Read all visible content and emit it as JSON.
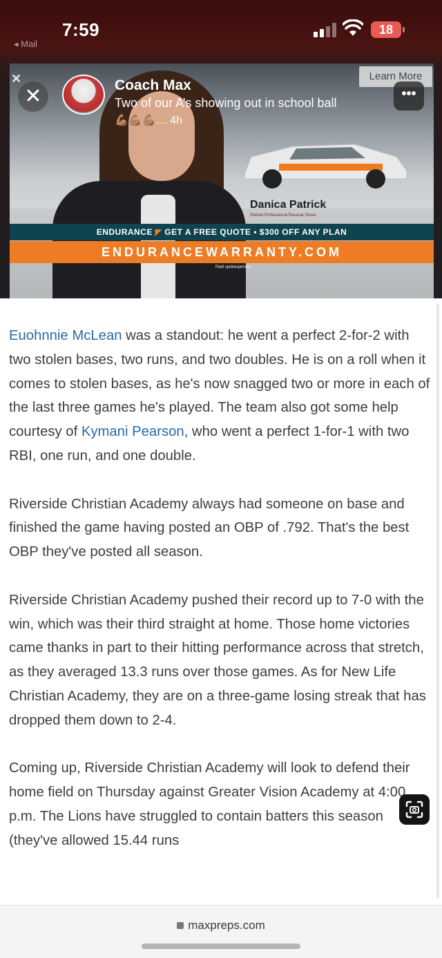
{
  "status_bar": {
    "time": "7:59",
    "back_label": "◂ Mail",
    "battery": "18"
  },
  "ad": {
    "learn_more": "Learn More",
    "spokesperson_name": "Danica Patrick",
    "spokesperson_title": "Retired Professional Racecar Driver",
    "brand": "ENDURANCE",
    "offer": "GET A FREE QUOTE • $300 OFF ANY PLAN",
    "url": "ENDURANCEWARRANTY.COM",
    "paid": "Paid spokesperson"
  },
  "story": {
    "username": "Coach Max",
    "caption": "Two of our A’s showing out in school ball",
    "reactions": "💪🏽💪🏽💪🏽… 4h"
  },
  "article": {
    "p1_link1": "Euohnnie McLean",
    "p1_text1": " was a standout: he went a perfect 2-for-2 with two stolen bases, two runs, and two doubles. He is on a roll when it comes to stolen bases, as he's now snagged two or more in each of the last three games he's played. The team also got some help courtesy of ",
    "p1_link2": "Kymani Pearson",
    "p1_text2": ", who went a perfect 1-for-1 with two RBI, one run, and one double.",
    "p2": "Riverside Christian Academy always had someone on base and finished the game having posted an OBP of .792. That's the best OBP they've posted all season.",
    "p3": "Riverside Christian Academy pushed their record up to 7-0 with the win, which was their third straight at home. Those home victories came thanks in part to their hitting performance across that stretch, as they averaged 13.3 runs over those games. As for New Life Christian Academy, they are on a three-game losing streak that has dropped them down to 2-4.",
    "p4": "Coming up, Riverside Christian Academy will look to defend their home field on Thursday against Greater Vision Academy at 4:00 p.m. The Lions have struggled to contain batters this season (they've allowed 15.44 runs"
  },
  "browser": {
    "domain": "maxpreps.com"
  },
  "colors": {
    "link": "#2b6aa6",
    "ad_orange": "#ee7c25",
    "ad_teal": "#0f4350",
    "battery_red": "#e85a52"
  }
}
